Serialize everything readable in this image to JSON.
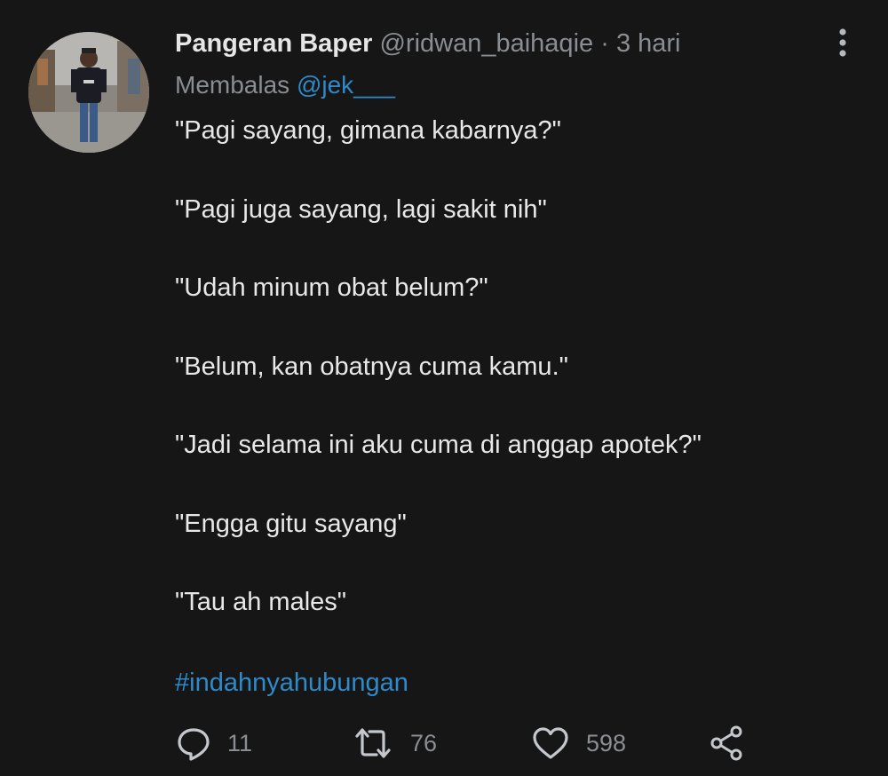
{
  "tweet": {
    "author": {
      "display_name": "Pangeran Baper",
      "handle": "@ridwan_baihaqie",
      "separator": "·",
      "time": "3 hari"
    },
    "reply": {
      "prefix": "Membalas",
      "target": "@jek___"
    },
    "lines": [
      "\"Pagi sayang, gimana kabarnya?\"",
      "\"Pagi juga sayang, lagi sakit nih\"",
      "\"Udah minum obat belum?\"",
      "\"Belum, kan obatnya cuma kamu.\"",
      "\"Jadi selama ini aku cuma di anggap apotek?\"",
      "\"Engga gitu sayang\"",
      "\"Tau ah males\""
    ],
    "hashtag": "#indahnyahubungan",
    "actions": {
      "replies": "11",
      "retweets": "76",
      "likes": "598"
    }
  },
  "icons": {
    "more": "more-vertical-icon",
    "reply": "reply-bubble-icon",
    "retweet": "retweet-icon",
    "like": "heart-icon",
    "share": "share-icon"
  },
  "colors": {
    "background": "#161616",
    "text": "#e8e8e8",
    "muted": "#8a8d91",
    "link": "#2e8ac9"
  }
}
